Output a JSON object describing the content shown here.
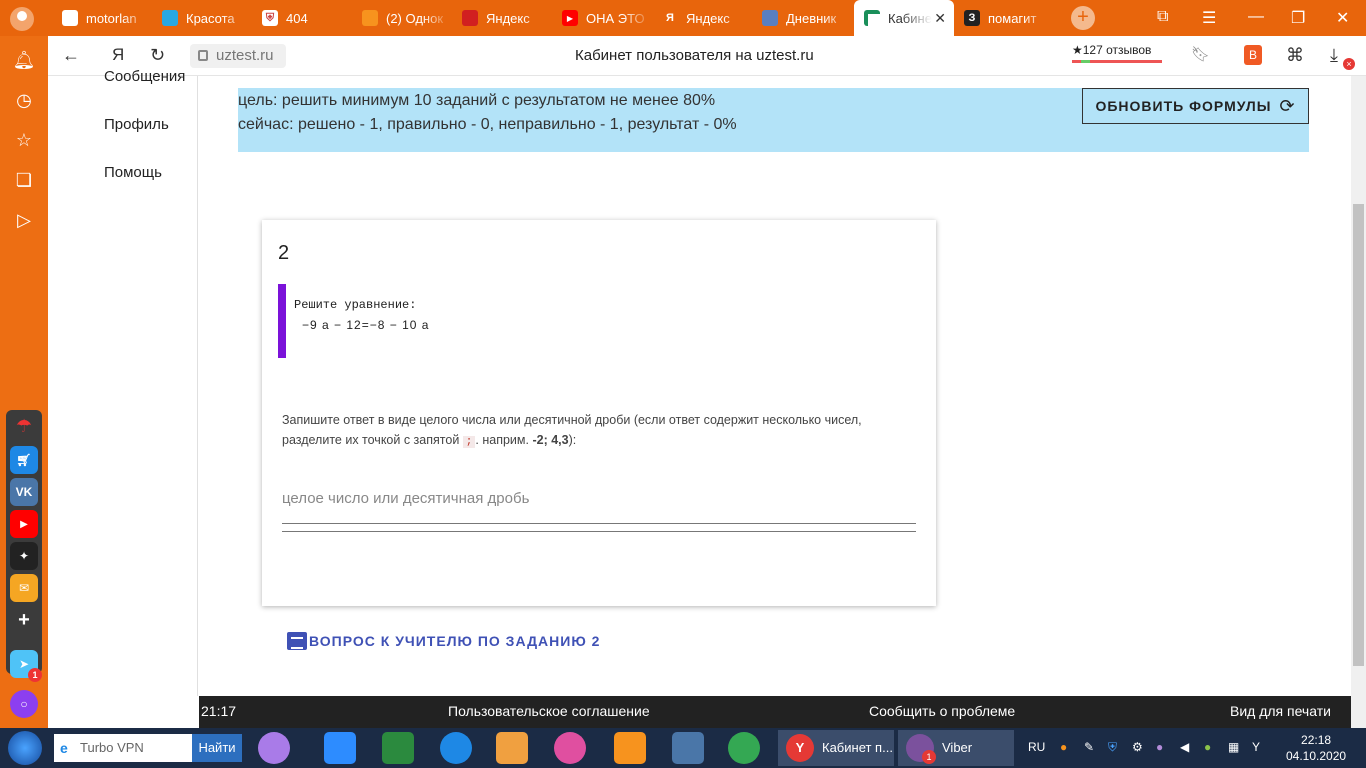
{
  "browser": {
    "tabs": [
      {
        "label": "motorlan",
        "color": "#4a90d9",
        "glyph": ""
      },
      {
        "label": "Красота",
        "color": "#2196f3",
        "glyph": ""
      },
      {
        "label": "404",
        "color": "#ffffff",
        "glyph": ""
      },
      {
        "label": "(2) Однок",
        "color": "#f7931e",
        "glyph": ""
      },
      {
        "label": "Яндекс",
        "color": "#e02020",
        "glyph": ""
      },
      {
        "label": "ОНА ЭТО",
        "color": "#ff0000",
        "glyph": "▶"
      },
      {
        "label": "Яндекс",
        "color": "#e02020",
        "glyph": "Я"
      },
      {
        "label": "Дневник",
        "color": "#5a7fc0",
        "glyph": ""
      },
      {
        "label": "Кабине",
        "color": "#1a8f5a",
        "glyph": ""
      },
      {
        "label": "помагит",
        "color": "#222222",
        "glyph": "З"
      }
    ],
    "url": "uztest.ru",
    "page_title": "Кабинет пользователя на uztest.ru",
    "reviews": "★127 отзывов",
    "notif_badge": "×"
  },
  "sitenav": {
    "items": [
      "Сообщения",
      "Профиль",
      "Помощь"
    ]
  },
  "goal": {
    "line1": "цель: решить минимум 10 заданий с результатом не менее 80%",
    "line2": "сейчас: решено - 1, правильно - 0, неправильно - 1, результат - 0%",
    "refresh_label": "ОБНОВИТЬ ФОРМУЛЫ"
  },
  "task": {
    "number": "2",
    "prompt": "Решите уравнение:",
    "equation": "−9 a − 12=−8 − 10 a",
    "hint_a": "Запишите ответ в виде целого числа или десятичной дроби (если ответ содержит несколько чисел, разделите их точкой с запятой",
    "hint_code": ";",
    "hint_b": ". наприм.",
    "hint_example": "-2; 4,3",
    "hint_end": "):",
    "answer_placeholder": "целое число или десятичная дробь",
    "ask_teacher": "ВОПРОС К УЧИТЕЛЮ ПО ЗАДАНИЮ 2"
  },
  "footer": {
    "time": "21:17",
    "agreement": "Пользовательское соглашение",
    "report": "Сообщить о проблеме",
    "print": "Вид для печати"
  },
  "taskbar": {
    "search_text": "Turbo VPN",
    "find_button": "Найти",
    "win1": "Кабинет п...",
    "win2": "Viber",
    "viber_badge": "1",
    "lang": "RU",
    "time": "22:18",
    "date": "04.10.2020"
  },
  "ysidebar": {
    "mail_badge": "1"
  }
}
